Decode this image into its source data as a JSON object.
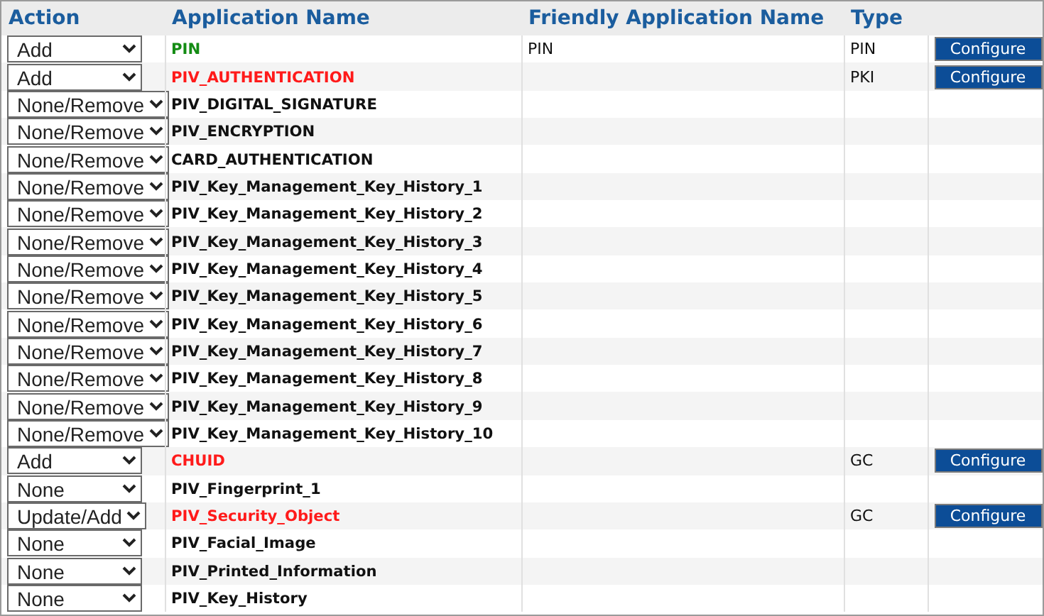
{
  "table": {
    "columns": [
      "Action",
      "Application Name",
      "Friendly Application Name",
      "Type"
    ],
    "rows": [
      {
        "action": "Add",
        "name": "PIN",
        "color": "#148c14",
        "friendly": "PIN",
        "type": "PIN",
        "button": "Configure"
      },
      {
        "action": "Add",
        "name": "PIV_AUTHENTICATION",
        "color": "#ff1a1a",
        "type": "PKI",
        "button": "Configure"
      },
      {
        "action": "None/Remove",
        "name": "PIV_DIGITAL_SIGNATURE",
        "color": "#111111"
      },
      {
        "action": "None/Remove",
        "name": "PIV_ENCRYPTION",
        "color": "#111111"
      },
      {
        "action": "None/Remove",
        "name": "CARD_AUTHENTICATION",
        "color": "#111111"
      },
      {
        "action": "None/Remove",
        "name": "PIV_Key_Management_Key_History_1",
        "color": "#111111"
      },
      {
        "action": "None/Remove",
        "name": "PIV_Key_Management_Key_History_2",
        "color": "#111111"
      },
      {
        "action": "None/Remove",
        "name": "PIV_Key_Management_Key_History_3",
        "color": "#111111"
      },
      {
        "action": "None/Remove",
        "name": "PIV_Key_Management_Key_History_4",
        "color": "#111111"
      },
      {
        "action": "None/Remove",
        "name": "PIV_Key_Management_Key_History_5",
        "color": "#111111"
      },
      {
        "action": "None/Remove",
        "name": "PIV_Key_Management_Key_History_6",
        "color": "#111111"
      },
      {
        "action": "None/Remove",
        "name": "PIV_Key_Management_Key_History_7",
        "color": "#111111"
      },
      {
        "action": "None/Remove",
        "name": "PIV_Key_Management_Key_History_8",
        "color": "#111111"
      },
      {
        "action": "None/Remove",
        "name": "PIV_Key_Management_Key_History_9",
        "color": "#111111"
      },
      {
        "action": "None/Remove",
        "name": "PIV_Key_Management_Key_History_10",
        "color": "#111111"
      },
      {
        "action": "Add",
        "name": "CHUID",
        "color": "#ff1a1a",
        "type": "GC",
        "button": "Configure"
      },
      {
        "action": "None",
        "name": "PIV_Fingerprint_1",
        "color": "#111111"
      },
      {
        "action": "Update/Add",
        "name": "PIV_Security_Object",
        "color": "#ff1a1a",
        "type": "GC",
        "button": "Configure"
      },
      {
        "action": "None",
        "name": "PIV_Facial_Image",
        "color": "#111111"
      },
      {
        "action": "None",
        "name": "PIV_Printed_Information",
        "color": "#111111"
      },
      {
        "action": "None",
        "name": "PIV_Key_History",
        "color": "#111111"
      }
    ]
  }
}
